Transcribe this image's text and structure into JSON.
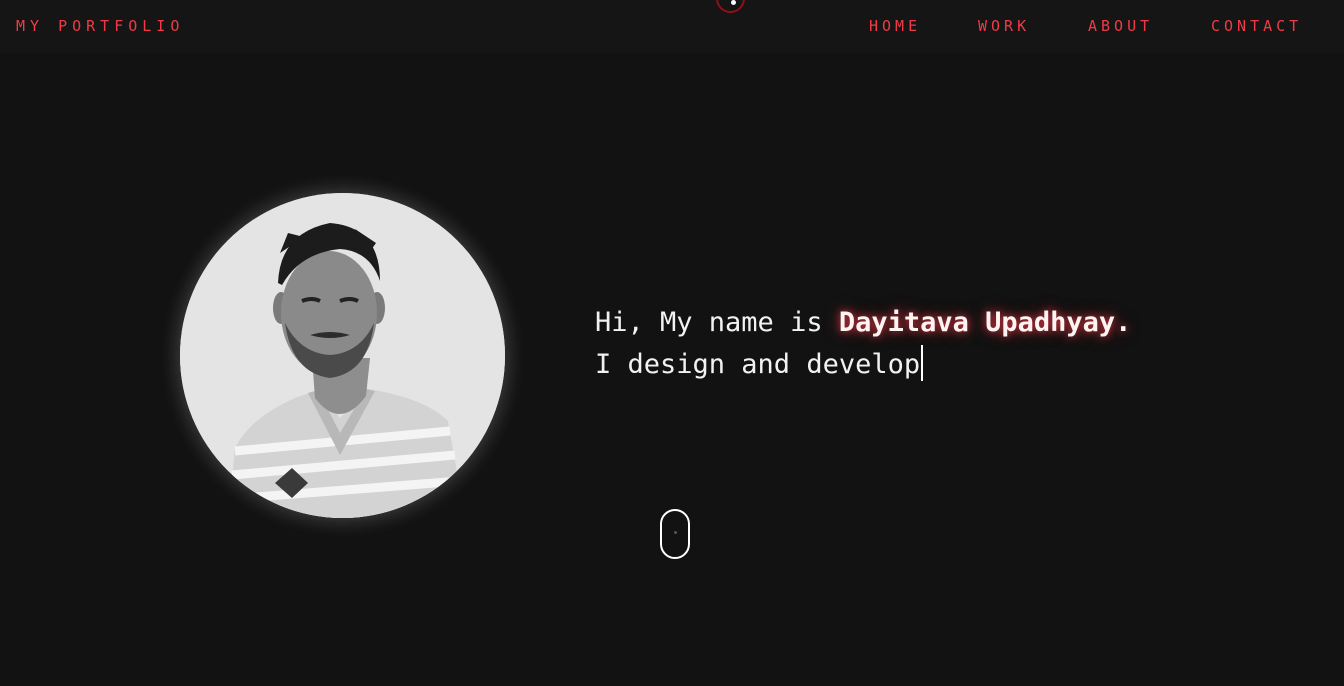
{
  "header": {
    "brand": "MY PORTFOLIO",
    "nav": [
      {
        "label": "HOME"
      },
      {
        "label": "WORK"
      },
      {
        "label": "ABOUT"
      },
      {
        "label": "CONTACT"
      }
    ]
  },
  "hero": {
    "greeting": "Hi, My name is ",
    "name": "Dayitava Upadhyay.",
    "typed_text": "I design and develop"
  },
  "colors": {
    "background": "#121212",
    "accent": "#ef3b47"
  }
}
